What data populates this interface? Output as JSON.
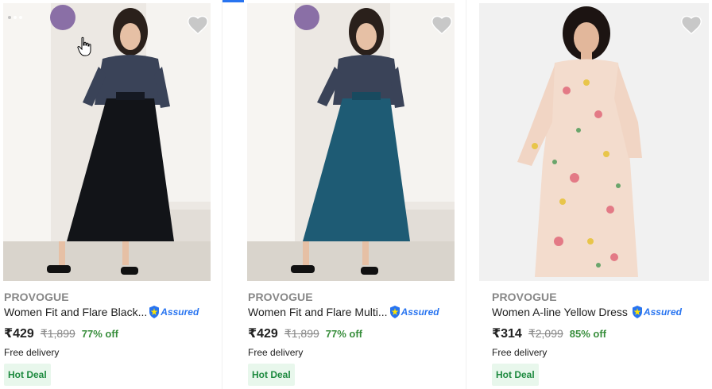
{
  "products": [
    {
      "brand": "PROVOGUE",
      "title": "Women Fit and Flare Black...",
      "assured": "Assured",
      "price": "₹429",
      "mrp": "₹1,899",
      "off": "77% off",
      "delivery": "Free delivery",
      "deal": "Hot Deal",
      "dress_colors": {
        "top": "#3a4358",
        "skirt": "#121418",
        "bg": "#ece8e3"
      }
    },
    {
      "brand": "PROVOGUE",
      "title": "Women Fit and Flare Multi...",
      "assured": "Assured",
      "price": "₹429",
      "mrp": "₹1,899",
      "off": "77% off",
      "delivery": "Free delivery",
      "deal": "Hot Deal",
      "dress_colors": {
        "top": "#3a4358",
        "skirt": "#1e5b74",
        "bg": "#ece8e3"
      }
    },
    {
      "brand": "PROVOGUE",
      "title": "Women A-line Yellow Dress",
      "assured": "Assured",
      "price": "₹314",
      "mrp": "₹2,099",
      "off": "85% off",
      "delivery": "Free delivery",
      "deal": "Hot Deal",
      "dress_colors": {
        "top": "#f3dccd",
        "skirt": "#f3dccd",
        "bg": "#eeeeee"
      }
    }
  ],
  "icons": {
    "wishlist": "heart-icon",
    "assured_badge": "shield-icon",
    "cursor": "hand-pointer-icon"
  },
  "colors": {
    "accent": "#2874f0",
    "discount": "#388e3c",
    "deal_bg": "#e8f7ec",
    "deal_text": "#1d8a3f"
  }
}
